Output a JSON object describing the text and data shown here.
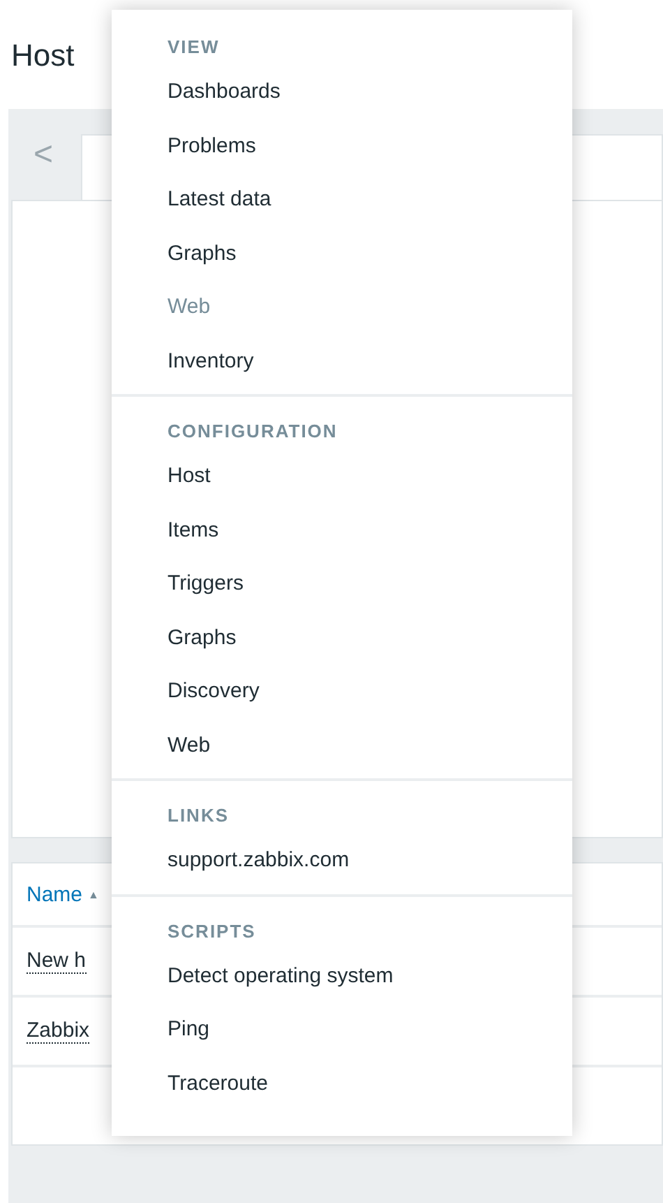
{
  "page": {
    "title": "Host",
    "back_button": "<"
  },
  "table": {
    "columns": [
      {
        "label": "Name",
        "sort": "▲"
      }
    ],
    "rows": [
      {
        "name": "New h"
      },
      {
        "name": "Zabbix"
      }
    ]
  },
  "context_menu": {
    "sections": [
      {
        "heading": "VIEW",
        "items": [
          {
            "label": "Dashboards",
            "disabled": false
          },
          {
            "label": "Problems",
            "disabled": false
          },
          {
            "label": "Latest data",
            "disabled": false
          },
          {
            "label": "Graphs",
            "disabled": false
          },
          {
            "label": "Web",
            "disabled": true
          },
          {
            "label": "Inventory",
            "disabled": false
          }
        ]
      },
      {
        "heading": "CONFIGURATION",
        "items": [
          {
            "label": "Host",
            "disabled": false
          },
          {
            "label": "Items",
            "disabled": false
          },
          {
            "label": "Triggers",
            "disabled": false
          },
          {
            "label": "Graphs",
            "disabled": false
          },
          {
            "label": "Discovery",
            "disabled": false
          },
          {
            "label": "Web",
            "disabled": false
          }
        ]
      },
      {
        "heading": "LINKS",
        "items": [
          {
            "label": "support.zabbix.com",
            "disabled": false
          }
        ]
      },
      {
        "heading": "SCRIPTS",
        "items": [
          {
            "label": "Detect operating system",
            "disabled": false
          },
          {
            "label": "Ping",
            "disabled": false
          },
          {
            "label": "Traceroute",
            "disabled": false
          }
        ]
      }
    ]
  }
}
